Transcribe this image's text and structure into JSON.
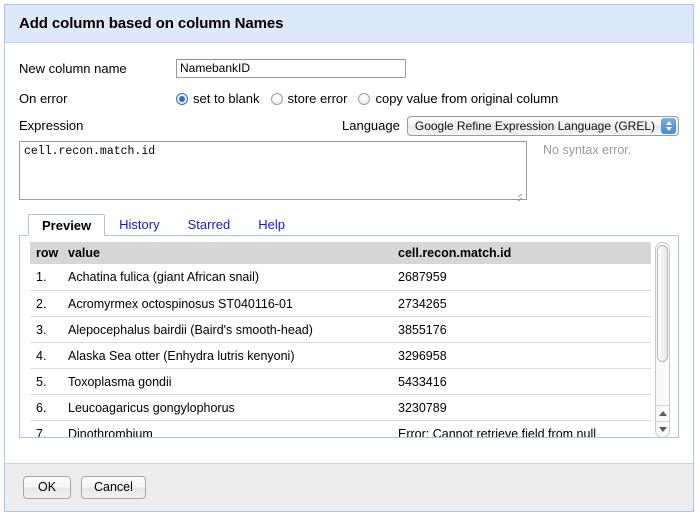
{
  "dialog": {
    "title": "Add column based on column Names"
  },
  "form": {
    "new_column_label": "New column name",
    "new_column_value": "NamebankID",
    "new_column_placeholder": "",
    "on_error_label": "On error",
    "on_error_options": [
      {
        "label": "set to blank",
        "selected": true
      },
      {
        "label": "store error",
        "selected": false
      },
      {
        "label": "copy value from original column",
        "selected": false
      }
    ],
    "expression_label": "Expression",
    "language_label": "Language",
    "language_value": "Google Refine Expression Language (GREL)",
    "expression_value": "cell.recon.match.id",
    "syntax_status": "No syntax error."
  },
  "tabs": [
    {
      "label": "Preview",
      "active": true
    },
    {
      "label": "History",
      "active": false
    },
    {
      "label": "Starred",
      "active": false
    },
    {
      "label": "Help",
      "active": false
    }
  ],
  "preview_table": {
    "columns": [
      "row",
      "value",
      "cell.recon.match.id"
    ],
    "rows": [
      {
        "row": "1.",
        "value": "Achatina fulica (giant African snail)",
        "result": "2687959",
        "is_error": false
      },
      {
        "row": "2.",
        "value": "Acromyrmex octospinosus ST040116-01",
        "result": "2734265",
        "is_error": false
      },
      {
        "row": "3.",
        "value": "Alepocephalus bairdii (Baird's smooth-head)",
        "result": "3855176",
        "is_error": false
      },
      {
        "row": "4.",
        "value": "Alaska Sea otter (Enhydra lutris kenyoni)",
        "result": "3296958",
        "is_error": false
      },
      {
        "row": "5.",
        "value": "Toxoplasma gondii",
        "result": "5433416",
        "is_error": false
      },
      {
        "row": "6.",
        "value": "Leucoagaricus gongylophorus",
        "result": "3230789",
        "is_error": false
      },
      {
        "row": "7.",
        "value": "Dinothrombium",
        "result": "Error: Cannot retrieve field from null",
        "is_error": true
      }
    ]
  },
  "footer": {
    "ok_label": "OK",
    "cancel_label": "Cancel"
  }
}
